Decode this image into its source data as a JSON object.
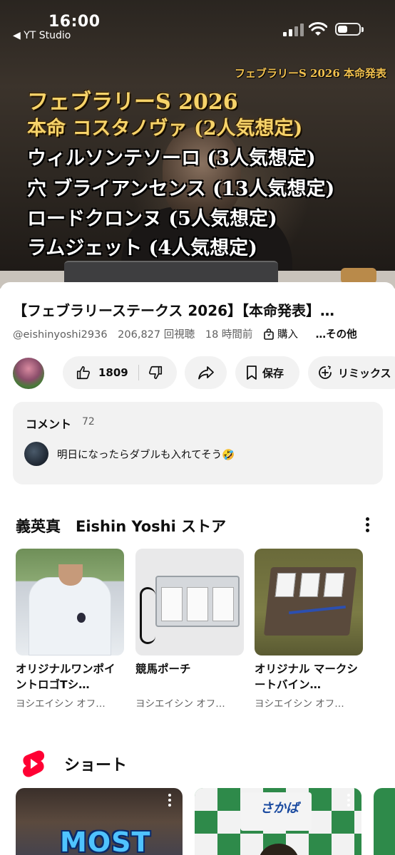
{
  "status": {
    "time": "16:00",
    "back_app": "◀ YT Studio"
  },
  "video": {
    "overlay_corner": "フェブラリーS 2026 本命発表",
    "overlay_lines": [
      "フェブラリーS 2026",
      "本命 コスタノヴァ (2人気想定)",
      "ウィルソンテソーロ (3人気想定)",
      "穴 ブライアンセンス (13人気想定)",
      "ロードクロンヌ (5人気想定)",
      "ラムジェット (4人気想定)"
    ]
  },
  "details": {
    "title": "【フェブラリーステークス 2026】【本命発表】…",
    "channel_handle": "@eishinyoshi2936",
    "views": "206,827 回視聴",
    "age": "18 時間前",
    "purchase": "購入",
    "more": "…その他"
  },
  "actions": {
    "like_count": "1809",
    "save_label": "保存",
    "remix_label": "リミックス"
  },
  "comments": {
    "heading": "コメント",
    "count": "72",
    "top_comment": "明日になったらダブルも入れてそう🤣"
  },
  "store": {
    "heading": "義英真　Eishin Yoshi ストア",
    "products": [
      {
        "name": "オリジナルワンポイントロゴTシ…",
        "seller": "ヨシエイシン オフ…"
      },
      {
        "name": "競馬ポーチ",
        "seller": "ヨシエイシン オフ…"
      },
      {
        "name": "オリジナル マークシートバイン…",
        "seller": "ヨシエイシン オフ…"
      }
    ]
  },
  "shorts": {
    "heading": "ショート",
    "short1_text": "MOST",
    "short2_badge": "さかば"
  },
  "colors": {
    "accent_red": "#ff0033",
    "pill_bg": "#f2f2f2",
    "text_secondary": "#606060"
  }
}
